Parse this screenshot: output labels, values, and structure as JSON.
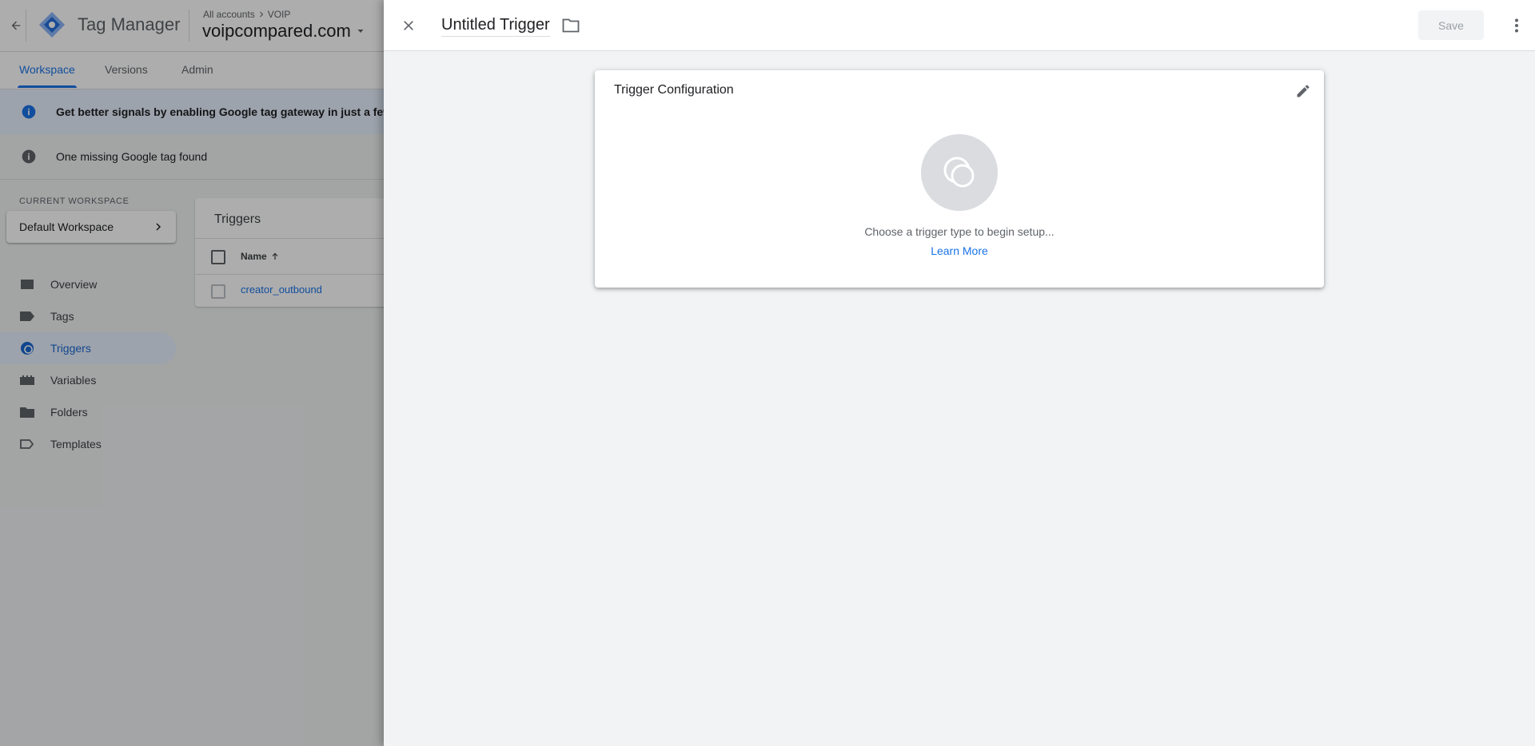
{
  "app": {
    "product_name": "Tag Manager",
    "breadcrumb": {
      "all_accounts": "All accounts",
      "account": "VOIP"
    },
    "container_name": "voipcompared.com",
    "tabs": [
      {
        "label": "Workspace",
        "active": true
      },
      {
        "label": "Versions",
        "active": false
      },
      {
        "label": "Admin",
        "active": false
      }
    ],
    "banners": {
      "gateway": "Get better signals by enabling Google tag gateway in just a few",
      "missing_tag": "One missing Google tag found"
    },
    "workspace": {
      "label": "CURRENT WORKSPACE",
      "name": "Default Workspace"
    },
    "nav": [
      {
        "label": "Overview",
        "icon": "overview-icon",
        "active": false
      },
      {
        "label": "Tags",
        "icon": "tag-icon",
        "active": false
      },
      {
        "label": "Triggers",
        "icon": "trigger-icon",
        "active": true
      },
      {
        "label": "Variables",
        "icon": "variables-icon",
        "active": false
      },
      {
        "label": "Folders",
        "icon": "folder-icon",
        "active": false
      },
      {
        "label": "Templates",
        "icon": "templates-icon",
        "active": false
      }
    ],
    "triggers_table": {
      "title": "Triggers",
      "column_name": "Name",
      "rows": [
        {
          "name": "creator_outbound"
        }
      ]
    }
  },
  "sheet": {
    "title": "Untitled Trigger",
    "save_label": "Save",
    "config_card": {
      "title": "Trigger Configuration",
      "hint": "Choose a trigger type to begin setup...",
      "learn_more": "Learn More"
    }
  },
  "colors": {
    "accent": "#1a73e8",
    "gtm_logo_dark": "#246fdb",
    "gtm_logo_light": "#8ab4f8",
    "scrim": "rgba(0,0,0,0.32)"
  }
}
